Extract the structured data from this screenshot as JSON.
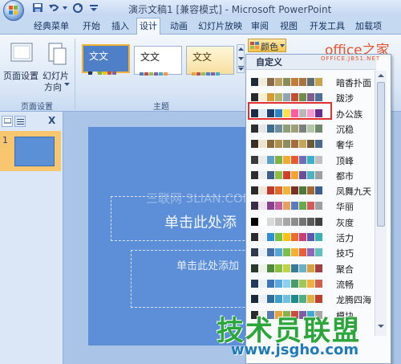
{
  "app": {
    "title": "演示文稿1 [兼容模式] - Microsoft PowerPoint",
    "colors": {
      "accent": "#3c6fb4",
      "ribbon": "#dfeaf7",
      "slide": "#5d8fd8",
      "highlight": "#e03030"
    }
  },
  "quick_access": {
    "icons": [
      "save-icon",
      "undo-icon",
      "redo-icon",
      "customize-icon"
    ]
  },
  "tabs": [
    {
      "label": "经典菜单"
    },
    {
      "label": "开始"
    },
    {
      "label": "插入"
    },
    {
      "label": "设计",
      "active": true
    },
    {
      "label": "动画"
    },
    {
      "label": "幻灯片放映"
    },
    {
      "label": "审阅"
    },
    {
      "label": "视图"
    },
    {
      "label": "开发工具"
    },
    {
      "label": "加载项"
    }
  ],
  "ribbon": {
    "page_setup": {
      "button1": "页面设置",
      "button2_line1": "幻灯片",
      "button2_line2": "方向",
      "group_label": "页面设置"
    },
    "themes": {
      "group_label": "主题",
      "sample_text": "文文",
      "colors_button": "颜色"
    }
  },
  "left_pane": {
    "slide_number": "1",
    "close": "X"
  },
  "slide": {
    "title_placeholder": "单击此处添",
    "subtitle_placeholder": "单击此处添加"
  },
  "color_menu": {
    "header": "自定义",
    "items": [
      {
        "name": "暗香扑面",
        "colors": [
          "#1e2a38",
          "#f2ecd8",
          "#8c6b4a",
          "#bba05f",
          "#8a8d5b",
          "#c27d3d",
          "#a8733d",
          "#5d6b74",
          "#c9a24a"
        ]
      },
      {
        "name": "跋涉",
        "colors": [
          "#2b2b2b",
          "#f6efd2",
          "#d79a32",
          "#b2b56b",
          "#8fa5b3",
          "#c24e34",
          "#6f8c4c",
          "#7f5b8e",
          "#4e6f99"
        ]
      },
      {
        "name": "办公族",
        "colors": [
          "#1b2b4a",
          "#dfe9f6",
          "#1f3e70",
          "#2b83c6",
          "#ffe14d",
          "#ff5aa5",
          "#b8b8b8",
          "#f89ad0",
          "#6a2c91"
        ],
        "highlighted": true
      },
      {
        "name": "沉稳",
        "colors": [
          "#2e2e2e",
          "#e7e7e7",
          "#3e6d8e",
          "#6f8e9f",
          "#8e9f76",
          "#9fa07a",
          "#7e7e7e",
          "#b3c6a8",
          "#6e8a6e"
        ]
      },
      {
        "name": "奢华",
        "colors": [
          "#3b2f25",
          "#efe5cf",
          "#8c6a3c",
          "#b08f4c",
          "#8c8c5c",
          "#a86c3c",
          "#c4a55a",
          "#6a5a3a",
          "#4a6a8a"
        ]
      },
      {
        "name": "顶峰",
        "colors": [
          "#3a3a3a",
          "#e8eaec",
          "#5e9fca",
          "#82b041",
          "#f0ab37",
          "#e85a2e",
          "#6f6fb5",
          "#3cb0c9",
          "#bfbfbf"
        ]
      },
      {
        "name": "都市",
        "colors": [
          "#2d2d2d",
          "#eceff1",
          "#3f5e8c",
          "#8bbf43",
          "#cf3d2e",
          "#f2a530",
          "#6b4f9b",
          "#4fb2c1",
          "#9e9e9e"
        ]
      },
      {
        "name": "凤舞九天",
        "colors": [
          "#2a2a2a",
          "#f3e6d8",
          "#c23a2b",
          "#e06b2d",
          "#f0b53b",
          "#7c2f25",
          "#4e7a39",
          "#a36832",
          "#3a5e8c"
        ]
      },
      {
        "name": "华丽",
        "colors": [
          "#3a2b4a",
          "#efe3f0",
          "#8b3f8f",
          "#c45ea0",
          "#e3a25a",
          "#5a7bbd",
          "#6aa84f",
          "#d35b5b",
          "#a0a0a0"
        ]
      },
      {
        "name": "灰度",
        "colors": [
          "#000000",
          "#ffffff",
          "#d9d9d9",
          "#bfbfbf",
          "#a6a6a6",
          "#8c8c8c",
          "#737373",
          "#595959",
          "#404040"
        ]
      },
      {
        "name": "活力",
        "colors": [
          "#2c2c2c",
          "#f2f2f2",
          "#2f8fd6",
          "#7ac142",
          "#f6c21a",
          "#ef6a2b",
          "#c73e79",
          "#5a59b0",
          "#3ab1b0"
        ]
      },
      {
        "name": "技巧",
        "colors": [
          "#2e3b4e",
          "#eaf0f7",
          "#466fa8",
          "#55a8d6",
          "#7bc04e",
          "#f2b134",
          "#e85d3c",
          "#8e66b5",
          "#5ebfbf"
        ]
      },
      {
        "name": "聚合",
        "colors": [
          "#2a3a2a",
          "#eef2e8",
          "#4e8c3c",
          "#8cc040",
          "#c0d44a",
          "#3c7a9a",
          "#6ab0c8",
          "#d8a040",
          "#a04040"
        ]
      },
      {
        "name": "流畅",
        "colors": [
          "#233a5a",
          "#e8f0f8",
          "#3d74b8",
          "#5aa8e0",
          "#8cd0f0",
          "#4a9a6a",
          "#a0c858",
          "#f0b040",
          "#d06050"
        ]
      },
      {
        "name": "龙腾四海",
        "colors": [
          "#1a2a3a",
          "#eaf0f4",
          "#2e6e9e",
          "#3aa0c8",
          "#70c0e0",
          "#1e8a8a",
          "#4eb080",
          "#e0b040",
          "#c04030"
        ]
      },
      {
        "name": "模块",
        "colors": [
          "#2b2b2b",
          "#f0f0f0",
          "#5a7bb0",
          "#e8a33c",
          "#88b04b",
          "#c8503c",
          "#7b5ea7",
          "#40a8c8",
          "#a8a8a8"
        ]
      }
    ]
  },
  "watermarks": {
    "top_right": "office之家",
    "top_right_url": "OFFICE.JB51.NET",
    "center": "三联网 3LIAN.COM",
    "bottom_big": "技术员联盟",
    "bottom_url": "www.jsgho.com"
  }
}
